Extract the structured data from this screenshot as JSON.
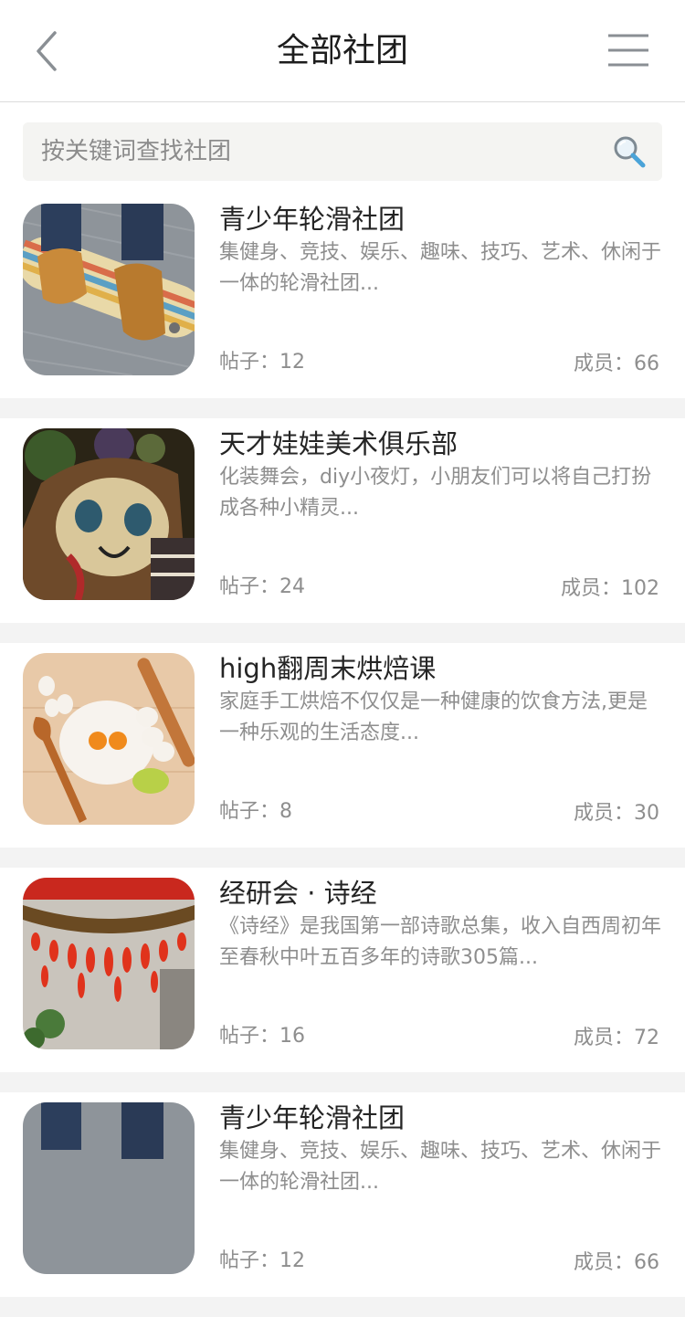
{
  "header": {
    "title": "全部社团",
    "back_icon": "chevron-left-icon",
    "menu_icon": "menu-icon"
  },
  "search": {
    "placeholder": "按关键词查找社团",
    "value": "",
    "icon": "search-icon"
  },
  "clubs": [
    {
      "name": "青少年轮滑社团",
      "desc": "集健身、竞技、娱乐、趣味、技巧、艺术、休闲于一体的轮滑社团...",
      "posts": "帖子：12",
      "members": "成员：66"
    },
    {
      "name": "天才娃娃美术俱乐部",
      "desc": "化装舞会，diy小夜灯，小朋友们可以将自己打扮成各种小精灵...",
      "posts": "帖子：24",
      "members": "成员：102"
    },
    {
      "name": "high翻周末烘焙课",
      "desc": "家庭手工烘焙不仅仅是一种健康的饮食方法,更是一种乐观的生活态度...",
      "posts": "帖子：8",
      "members": "成员：30"
    },
    {
      "name": "经研会 · 诗经",
      "desc": "《诗经》是我国第一部诗歌总集，收入自西周初年至春秋中叶五百多年的诗歌305篇...",
      "posts": "帖子：16",
      "members": "成员：72"
    },
    {
      "name": "青少年轮滑社团",
      "desc": "集健身、竞技、娱乐、趣味、技巧、艺术、休闲于一体的轮滑社团...",
      "posts": "帖子：12",
      "members": "成员：66"
    }
  ],
  "colors": {
    "background": "#f3f3f3",
    "title": "#1d1d1d",
    "muted": "#8e8e8e",
    "search_icon": "#4aa3d8"
  }
}
